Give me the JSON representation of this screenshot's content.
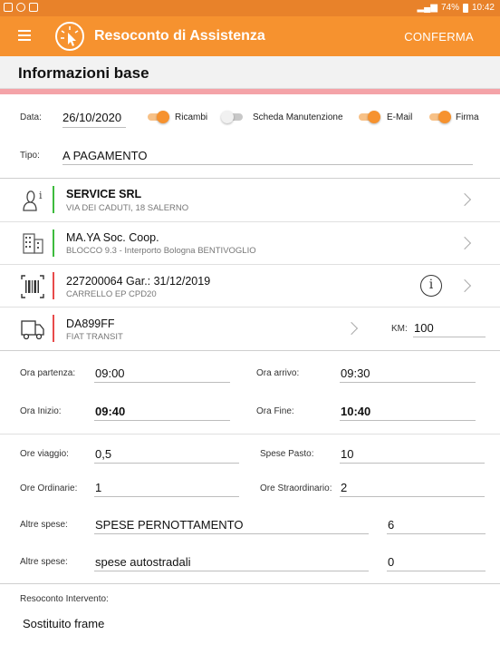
{
  "status_bar": {
    "battery": "74%",
    "time": "10:42"
  },
  "app_bar": {
    "title": "Resoconto di Assistenza",
    "action": "CONFERMA"
  },
  "section": {
    "title": "Informazioni base"
  },
  "form": {
    "data_label": "Data:",
    "data_value": "26/10/2020",
    "toggles": [
      {
        "label": "Ricambi",
        "on": true
      },
      {
        "label": "Scheda Manutenzione",
        "on": false
      },
      {
        "label": "E-Mail",
        "on": true
      },
      {
        "label": "Firma",
        "on": true
      }
    ],
    "tipo_label": "Tipo:",
    "tipo_value": "A PAGAMENTO"
  },
  "rows": [
    {
      "icon": "person-icon",
      "title": "SERVICE SRL",
      "subtitle": "VIA DEI CADUTI, 18 SALERNO",
      "accent": "#3dbb3d"
    },
    {
      "icon": "building-icon",
      "title": "MA.YA Soc. Coop.",
      "subtitle": "BLOCCO 9.3 - Interporto Bologna BENTIVOGLIO",
      "accent": "#3dbb3d"
    },
    {
      "icon": "barcode-icon",
      "title": "227200064 Gar.: 31/12/2019",
      "subtitle": "CARRELLO EP CPD20",
      "accent": "#e84b4b"
    },
    {
      "icon": "truck-icon",
      "title": "DA899FF",
      "subtitle": "FIAT TRANSIT",
      "accent": "#e84b4b",
      "km_label": "KM:",
      "km_value": "100"
    }
  ],
  "times": {
    "ora_partenza_label": "Ora partenza:",
    "ora_partenza": "09:00",
    "ora_arrivo_label": "Ora arrivo:",
    "ora_arrivo": "09:30",
    "ora_inizio_label": "Ora Inizio:",
    "ora_inizio": "09:40",
    "ora_fine_label": "Ora Fine:",
    "ora_fine": "10:40"
  },
  "hours": {
    "ore_viaggio_label": "Ore viaggio:",
    "ore_viaggio": "0,5",
    "spese_pasto_label": "Spese Pasto:",
    "spese_pasto": "10",
    "ore_ordinarie_label": "Ore Ordinarie:",
    "ore_ordinarie": "1",
    "ore_straordinario_label": "Ore Straordinario:",
    "ore_straordinario": "2"
  },
  "expenses": [
    {
      "label": "Altre spese:",
      "description": "SPESE PERNOTTAMENTO",
      "amount": "6"
    },
    {
      "label": "Altre spese:",
      "description": "spese autostradali",
      "amount": "0"
    }
  ],
  "resoconto": {
    "label": "Resoconto Intervento:",
    "value": "Sostituito frame"
  },
  "colors": {
    "primary": "#f6922f",
    "status": "#e8822a",
    "pink_bar": "#f4a3a8"
  }
}
